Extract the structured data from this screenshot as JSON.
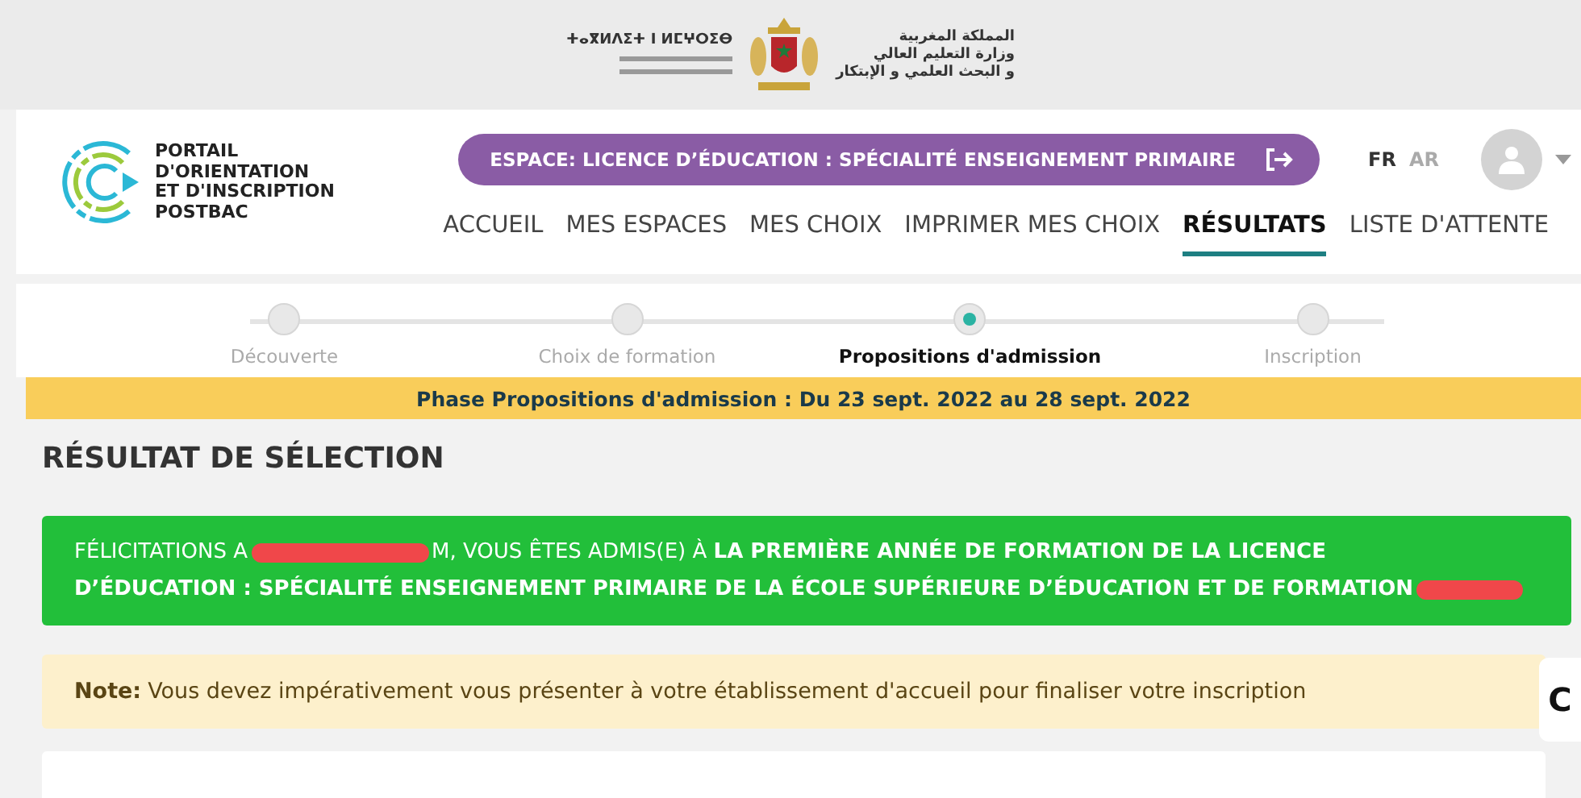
{
  "ministry_header": {
    "tifinagh_title": "ⵜⴰⴳⵍⴷⵉⵜ ⵏ ⵍⵎⵖⵔⵉⴱ",
    "arabic_lines": [
      "المملكة المغربية",
      "وزارة التعليم العالي",
      "و البحث العلمي و الإبتكار"
    ]
  },
  "logo": {
    "lines": [
      "PORTAIL",
      "D'ORIENTATION",
      "ET D'INSCRIPTION",
      "POSTBAC"
    ]
  },
  "space_pill": {
    "label": "ESPACE: LICENCE D’ÉDUCATION : SPÉCIALITÉ ENSEIGNEMENT PRIMAIRE"
  },
  "languages": [
    {
      "label": "FR",
      "selected": true
    },
    {
      "label": "AR",
      "selected": false
    }
  ],
  "nav": [
    {
      "label": "ACCUEIL",
      "selected": false
    },
    {
      "label": "MES ESPACES",
      "selected": false
    },
    {
      "label": "MES CHOIX",
      "selected": false
    },
    {
      "label": "IMPRIMER MES CHOIX",
      "selected": false
    },
    {
      "label": "RÉSULTATS",
      "selected": true
    },
    {
      "label": "LISTE D'ATTENTE",
      "selected": false
    }
  ],
  "steps": [
    {
      "label": "Découverte",
      "selected": false
    },
    {
      "label": "Choix de formation",
      "selected": false
    },
    {
      "label": "Propositions d'admission",
      "selected": true
    },
    {
      "label": "Inscription",
      "selected": false
    }
  ],
  "phase_banner": "Phase Propositions d'admission : Du 23 sept. 2022 au 28 sept. 2022",
  "title": "RÉSULTAT DE SÉLECTION",
  "success_message": {
    "before": "FÉLICITATIONS A",
    "after": "M, VOUS ÊTES ADMIS(E) À **LA PREMIÈRE ANNÉE DE FORMATION DE LA LICENCE**",
    "line_2": "D’ÉDUCATION : SPÉCIALITÉ ENSEIGNEMENT PRIMAIRE DE LA ÉCOLE SUPÉRIEURE D’ÉDUCATION ET DE FORMATION"
  },
  "note": {
    "label": "Note:",
    "text": "Vous devez impérativement vous présenter à votre établissement d'accueil pour finaliser votre inscription"
  },
  "side_tab": "C"
}
